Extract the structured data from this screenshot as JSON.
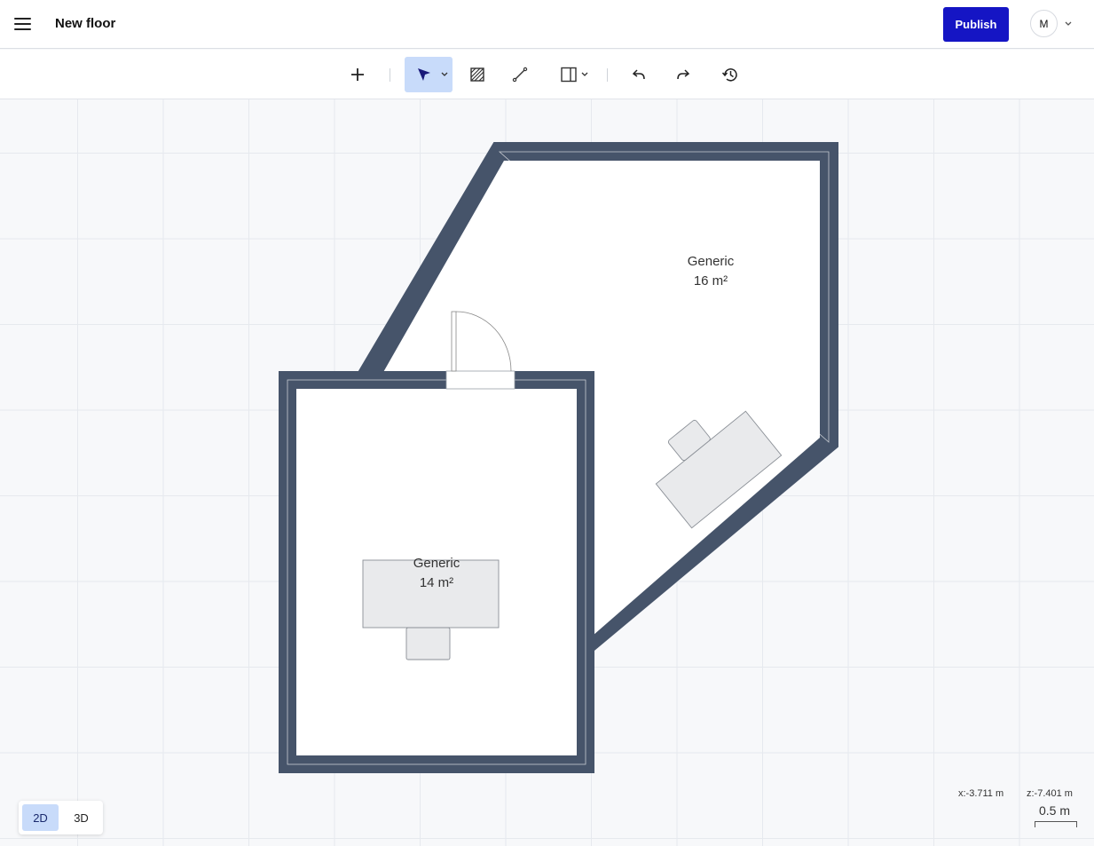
{
  "header": {
    "menu_icon": "hamburger-menu-icon",
    "title": "New floor",
    "publish_label": "Publish",
    "avatar_initial": "M"
  },
  "toolbar": {
    "tools": [
      {
        "name": "add",
        "icon": "plus-icon"
      },
      {
        "name": "select",
        "icon": "cursor-arrow-icon",
        "active": true
      },
      {
        "name": "floor",
        "icon": "hatch-icon"
      },
      {
        "name": "measure",
        "icon": "line-icon"
      },
      {
        "name": "wall-opening",
        "icon": "window-icon"
      },
      {
        "name": "undo",
        "icon": "undo-icon"
      },
      {
        "name": "redo",
        "icon": "redo-icon"
      },
      {
        "name": "history",
        "icon": "history-icon"
      }
    ]
  },
  "rooms": [
    {
      "type": "Generic",
      "area": "16 m²"
    },
    {
      "type": "Generic",
      "area": "14 m²"
    }
  ],
  "view": {
    "options": [
      "2D",
      "3D"
    ],
    "selected": "2D"
  },
  "status": {
    "x_coord": "x:-3.711 m",
    "z_coord": "z:-7.401 m",
    "scale": "0.5 m"
  },
  "colors": {
    "wall": "#46546a",
    "accent": "#1515c4",
    "active_tool": "#c8dbfa",
    "furniture": "#e9eaec"
  }
}
